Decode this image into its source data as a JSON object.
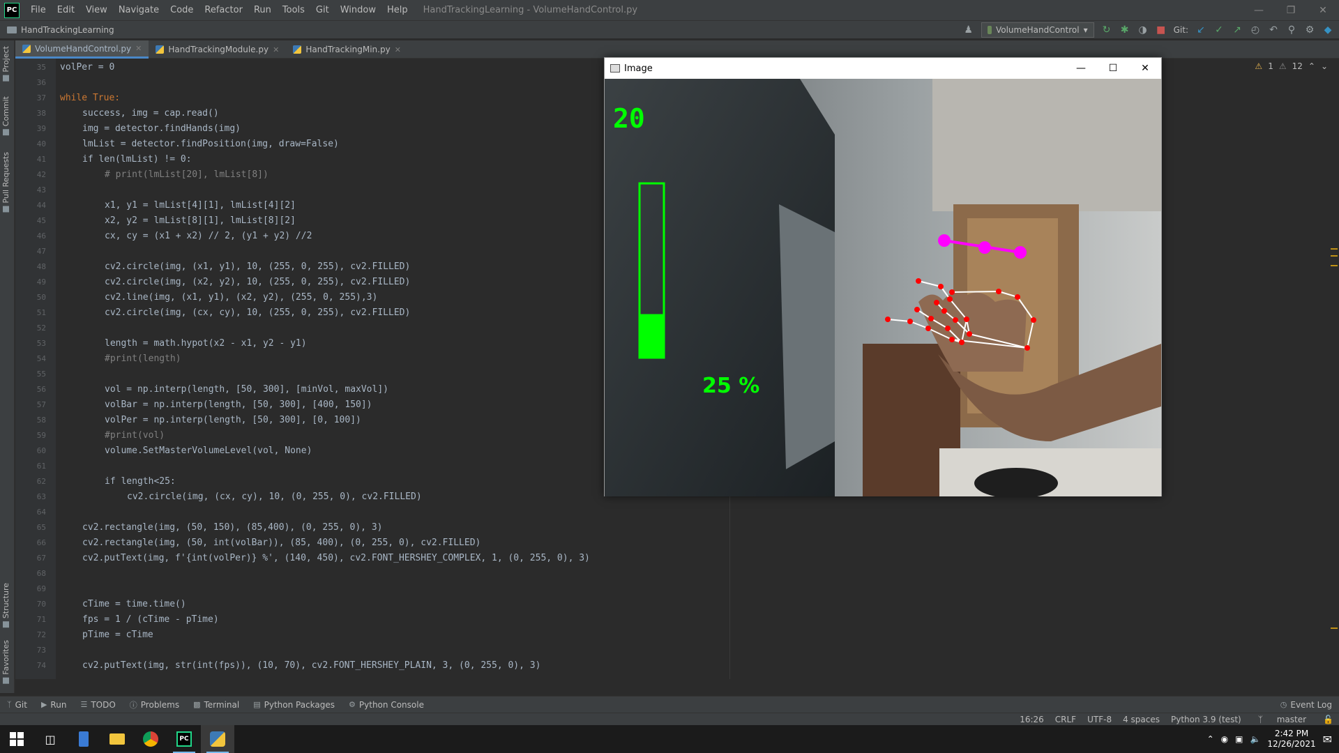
{
  "menubar": {
    "logo": "PC",
    "items": [
      "File",
      "Edit",
      "View",
      "Navigate",
      "Code",
      "Refactor",
      "Run",
      "Tools",
      "Git",
      "Window",
      "Help"
    ],
    "window_title": "HandTrackingLearning - VolumeHandControl.py"
  },
  "navbar": {
    "project": "HandTrackingLearning",
    "run_config": "VolumeHandControl",
    "git_label": "Git:"
  },
  "tabs": [
    {
      "label": "VolumeHandControl.py",
      "active": true
    },
    {
      "label": "HandTrackingModule.py",
      "active": false
    },
    {
      "label": "HandTrackingMin.py",
      "active": false
    }
  ],
  "side_tabs": {
    "project": "Project",
    "commit": "Commit",
    "pull_requests": "Pull Requests",
    "structure": "Structure",
    "favorites": "Favorites"
  },
  "inspections": {
    "warnings": "1",
    "weak_warnings": "12"
  },
  "code": [
    {
      "n": "35",
      "indent": 0,
      "text": "volPer = 0"
    },
    {
      "n": "36",
      "indent": 0,
      "text": ""
    },
    {
      "n": "37",
      "indent": 0,
      "text": "while True:"
    },
    {
      "n": "38",
      "indent": 1,
      "text": "success, img = cap.read()"
    },
    {
      "n": "39",
      "indent": 1,
      "text": "img = detector.findHands(img)"
    },
    {
      "n": "40",
      "indent": 1,
      "text": "lmList = detector.findPosition(img, draw=False)"
    },
    {
      "n": "41",
      "indent": 1,
      "text": "if len(lmList) != 0:"
    },
    {
      "n": "42",
      "indent": 2,
      "text": "# print(lmList[20], lmList[8])"
    },
    {
      "n": "43",
      "indent": 0,
      "text": ""
    },
    {
      "n": "44",
      "indent": 2,
      "text": "x1, y1 = lmList[4][1], lmList[4][2]"
    },
    {
      "n": "45",
      "indent": 2,
      "text": "x2, y2 = lmList[8][1], lmList[8][2]"
    },
    {
      "n": "46",
      "indent": 2,
      "text": "cx, cy = (x1 + x2) // 2, (y1 + y2) //2"
    },
    {
      "n": "47",
      "indent": 0,
      "text": ""
    },
    {
      "n": "48",
      "indent": 2,
      "text": "cv2.circle(img, (x1, y1), 10, (255, 0, 255), cv2.FILLED)"
    },
    {
      "n": "49",
      "indent": 2,
      "text": "cv2.circle(img, (x2, y2), 10, (255, 0, 255), cv2.FILLED)"
    },
    {
      "n": "50",
      "indent": 2,
      "text": "cv2.line(img, (x1, y1), (x2, y2), (255, 0, 255),3)"
    },
    {
      "n": "51",
      "indent": 2,
      "text": "cv2.circle(img, (cx, cy), 10, (255, 0, 255), cv2.FILLED)"
    },
    {
      "n": "52",
      "indent": 0,
      "text": ""
    },
    {
      "n": "53",
      "indent": 2,
      "text": "length = math.hypot(x2 - x1, y2 - y1)"
    },
    {
      "n": "54",
      "indent": 2,
      "text": "#print(length)"
    },
    {
      "n": "55",
      "indent": 0,
      "text": ""
    },
    {
      "n": "56",
      "indent": 2,
      "text": "vol = np.interp(length, [50, 300], [minVol, maxVol])"
    },
    {
      "n": "57",
      "indent": 2,
      "text": "volBar = np.interp(length, [50, 300], [400, 150])"
    },
    {
      "n": "58",
      "indent": 2,
      "text": "volPer = np.interp(length, [50, 300], [0, 100])"
    },
    {
      "n": "59",
      "indent": 2,
      "text": "#print(vol)"
    },
    {
      "n": "60",
      "indent": 2,
      "text": "volume.SetMasterVolumeLevel(vol, None)"
    },
    {
      "n": "61",
      "indent": 0,
      "text": ""
    },
    {
      "n": "62",
      "indent": 2,
      "text": "if length<25:"
    },
    {
      "n": "63",
      "indent": 3,
      "text": "cv2.circle(img, (cx, cy), 10, (0, 255, 0), cv2.FILLED)"
    },
    {
      "n": "64",
      "indent": 0,
      "text": ""
    },
    {
      "n": "65",
      "indent": 1,
      "text": "cv2.rectangle(img, (50, 150), (85,400), (0, 255, 0), 3)"
    },
    {
      "n": "66",
      "indent": 1,
      "text": "cv2.rectangle(img, (50, int(volBar)), (85, 400), (0, 255, 0), cv2.FILLED)"
    },
    {
      "n": "67",
      "indent": 1,
      "text": "cv2.putText(img, f'{int(volPer)} %', (140, 450), cv2.FONT_HERSHEY_COMPLEX, 1, (0, 255, 0), 3)"
    },
    {
      "n": "68",
      "indent": 0,
      "text": ""
    },
    {
      "n": "69",
      "indent": 0,
      "text": ""
    },
    {
      "n": "70",
      "indent": 1,
      "text": "cTime = time.time()"
    },
    {
      "n": "71",
      "indent": 1,
      "text": "fps = 1 / (cTime - pTime)"
    },
    {
      "n": "72",
      "indent": 1,
      "text": "pTime = cTime"
    },
    {
      "n": "73",
      "indent": 0,
      "text": ""
    },
    {
      "n": "74",
      "indent": 1,
      "text": "cv2.putText(img, str(int(fps)), (10, 70), cv2.FONT_HERSHEY_PLAIN, 3, (0, 255, 0), 3)"
    }
  ],
  "image_window": {
    "title": "Image",
    "fps": "20",
    "vol_percent_label": "25 %",
    "vol_fraction": 0.25,
    "overlay_color": "#00ff00",
    "landmark_color": "#ff00ff"
  },
  "bottom_tools": [
    "Git",
    "Run",
    "TODO",
    "Problems",
    "Terminal",
    "Python Packages",
    "Python Console"
  ],
  "event_log": "Event Log",
  "status": {
    "position": "16:26",
    "line_sep": "CRLF",
    "encoding": "UTF-8",
    "indent": "4 spaces",
    "interpreter": "Python 3.9 (test)",
    "branch": "master"
  },
  "taskbar": {
    "time": "2:42 PM",
    "date": "12/26/2021"
  }
}
